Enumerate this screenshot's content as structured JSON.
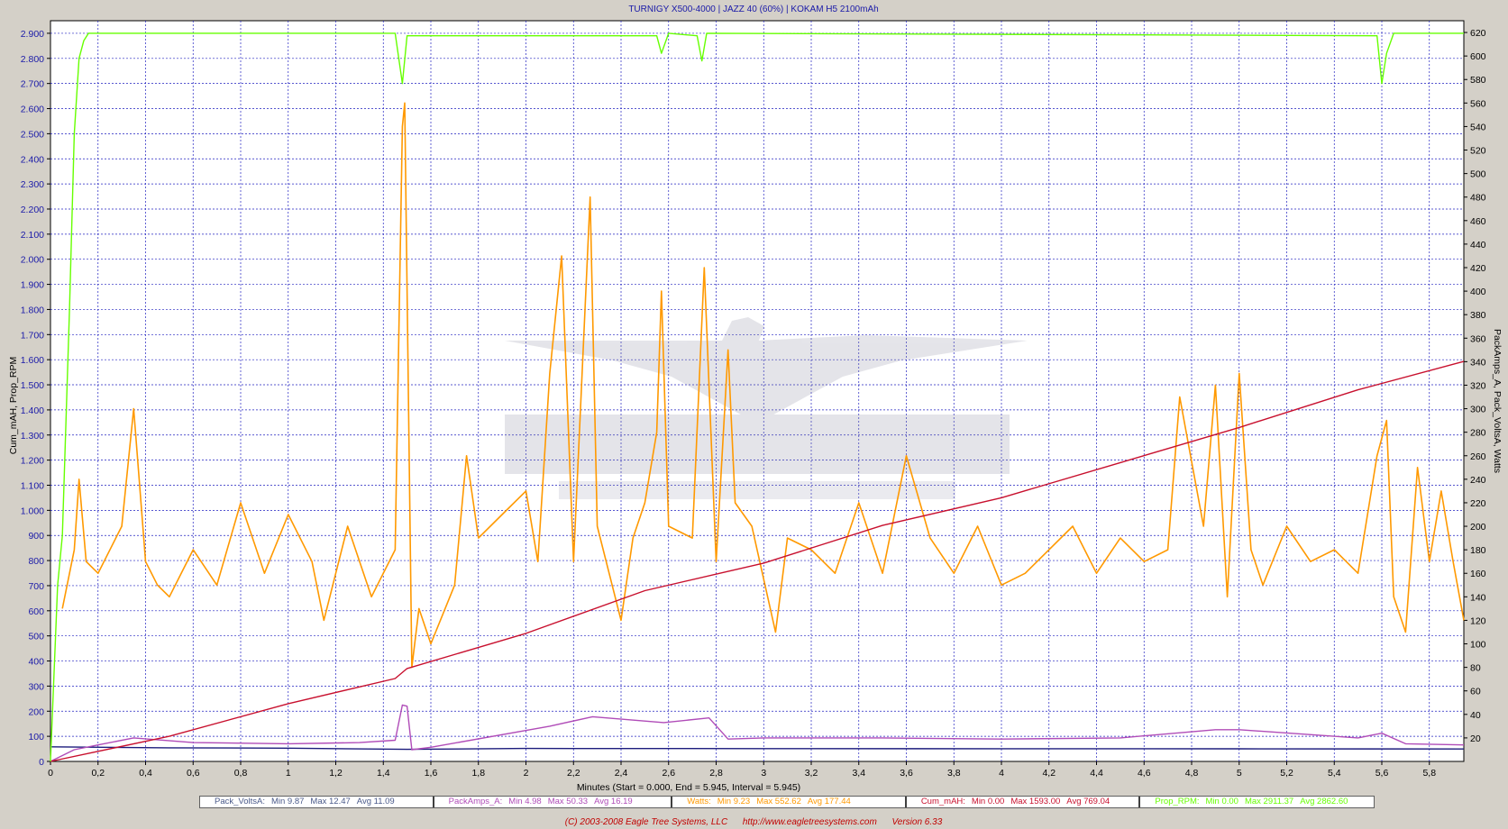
{
  "chart_data": {
    "type": "line",
    "title": "TURNIGY X500-4000 | JAZZ 40 (60%) | KOKAM H5 2100mAh",
    "xlabel": "Minutes (Start = 0.000,  End = 5.945,  Interval =  5.945)",
    "ylabel_left": "Cum_mAH, Prop_RPM",
    "ylabel_right": "PackAmps_A, Pack_VoltsA, Watts",
    "xlim": [
      0,
      5.945
    ],
    "ylim_left": [
      0,
      2950
    ],
    "ylim_right": [
      0,
      630
    ],
    "x_ticks": [
      "0",
      "0,2",
      "0,4",
      "0,6",
      "0,8",
      "1",
      "1,2",
      "1,4",
      "1,6",
      "1,8",
      "2",
      "2,2",
      "2,4",
      "2,6",
      "2,8",
      "3",
      "3,2",
      "3,4",
      "3,6",
      "3,8",
      "4",
      "4,2",
      "4,4",
      "4,6",
      "4,8",
      "5",
      "5,2",
      "5,4",
      "5,6",
      "5,8"
    ],
    "y_left_ticks": [
      "0",
      "100",
      "200",
      "300",
      "400",
      "500",
      "600",
      "700",
      "800",
      "900",
      "1.000",
      "1.100",
      "1.200",
      "1.300",
      "1.400",
      "1.500",
      "1.600",
      "1.700",
      "1.800",
      "1.900",
      "2.000",
      "2.100",
      "2.200",
      "2.300",
      "2.400",
      "2.500",
      "2.600",
      "2.700",
      "2.800",
      "2.900"
    ],
    "y_right_ticks": [
      "20",
      "40",
      "60",
      "80",
      "100",
      "120",
      "140",
      "160",
      "180",
      "200",
      "220",
      "240",
      "260",
      "280",
      "300",
      "320",
      "340",
      "360",
      "380",
      "400",
      "420",
      "440",
      "460",
      "480",
      "500",
      "520",
      "540",
      "560",
      "580",
      "600",
      "620"
    ],
    "grid": true,
    "legend_placement": "bottom",
    "series": [
      {
        "name": "Pack_VoltsA",
        "axis": "right",
        "color": "#1c1c7c",
        "points": [
          [
            0,
            12.4
          ],
          [
            0.5,
            11.6
          ],
          [
            1,
            11.3
          ],
          [
            1.5,
            10.3
          ],
          [
            2,
            11.0
          ],
          [
            3,
            10.9
          ],
          [
            4,
            10.8
          ],
          [
            5,
            10.7
          ],
          [
            5.945,
            10.6
          ]
        ],
        "stats": {
          "Min": "9.87",
          "Max": "12.47",
          "Avg": "11.09"
        }
      },
      {
        "name": "PackAmps_A",
        "axis": "right",
        "color": "#b04cb8",
        "points": [
          [
            0,
            0
          ],
          [
            0.05,
            5
          ],
          [
            0.1,
            10
          ],
          [
            0.2,
            14
          ],
          [
            0.35,
            20
          ],
          [
            0.6,
            16
          ],
          [
            1.0,
            15
          ],
          [
            1.3,
            16
          ],
          [
            1.45,
            18
          ],
          [
            1.48,
            48
          ],
          [
            1.5,
            47
          ],
          [
            1.52,
            10
          ],
          [
            1.6,
            12
          ],
          [
            2.1,
            30
          ],
          [
            2.28,
            38
          ],
          [
            2.58,
            33
          ],
          [
            2.77,
            37
          ],
          [
            2.85,
            19
          ],
          [
            3.0,
            20
          ],
          [
            3.5,
            20
          ],
          [
            4.0,
            19
          ],
          [
            4.5,
            20
          ],
          [
            4.9,
            27
          ],
          [
            5.0,
            27
          ],
          [
            5.5,
            20
          ],
          [
            5.6,
            24
          ],
          [
            5.7,
            15
          ],
          [
            5.945,
            14
          ]
        ],
        "stats": {
          "Min": "4.98",
          "Max": "50.33",
          "Avg": "16.19"
        }
      },
      {
        "name": "Watts",
        "axis": "right",
        "color": "#ff9900",
        "points": [
          [
            0.05,
            130
          ],
          [
            0.1,
            180
          ],
          [
            0.12,
            240
          ],
          [
            0.15,
            170
          ],
          [
            0.2,
            160
          ],
          [
            0.3,
            200
          ],
          [
            0.35,
            300
          ],
          [
            0.4,
            170
          ],
          [
            0.45,
            150
          ],
          [
            0.5,
            140
          ],
          [
            0.6,
            180
          ],
          [
            0.7,
            150
          ],
          [
            0.8,
            220
          ],
          [
            0.9,
            160
          ],
          [
            1.0,
            210
          ],
          [
            1.1,
            170
          ],
          [
            1.15,
            120
          ],
          [
            1.25,
            200
          ],
          [
            1.35,
            140
          ],
          [
            1.45,
            180
          ],
          [
            1.48,
            540
          ],
          [
            1.49,
            560
          ],
          [
            1.52,
            80
          ],
          [
            1.55,
            130
          ],
          [
            1.6,
            100
          ],
          [
            1.7,
            150
          ],
          [
            1.75,
            260
          ],
          [
            1.8,
            190
          ],
          [
            1.9,
            210
          ],
          [
            2.0,
            230
          ],
          [
            2.05,
            170
          ],
          [
            2.1,
            330
          ],
          [
            2.15,
            430
          ],
          [
            2.2,
            170
          ],
          [
            2.27,
            480
          ],
          [
            2.3,
            200
          ],
          [
            2.4,
            120
          ],
          [
            2.45,
            190
          ],
          [
            2.5,
            220
          ],
          [
            2.55,
            280
          ],
          [
            2.57,
            400
          ],
          [
            2.6,
            200
          ],
          [
            2.7,
            190
          ],
          [
            2.75,
            420
          ],
          [
            2.8,
            170
          ],
          [
            2.85,
            350
          ],
          [
            2.88,
            220
          ],
          [
            2.95,
            200
          ],
          [
            3.05,
            110
          ],
          [
            3.1,
            190
          ],
          [
            3.2,
            180
          ],
          [
            3.3,
            160
          ],
          [
            3.4,
            220
          ],
          [
            3.5,
            160
          ],
          [
            3.6,
            260
          ],
          [
            3.7,
            190
          ],
          [
            3.8,
            160
          ],
          [
            3.9,
            200
          ],
          [
            4.0,
            150
          ],
          [
            4.1,
            160
          ],
          [
            4.2,
            180
          ],
          [
            4.3,
            200
          ],
          [
            4.4,
            160
          ],
          [
            4.5,
            190
          ],
          [
            4.6,
            170
          ],
          [
            4.7,
            180
          ],
          [
            4.75,
            310
          ],
          [
            4.85,
            200
          ],
          [
            4.9,
            320
          ],
          [
            4.95,
            140
          ],
          [
            5.0,
            330
          ],
          [
            5.05,
            180
          ],
          [
            5.1,
            150
          ],
          [
            5.2,
            200
          ],
          [
            5.3,
            170
          ],
          [
            5.4,
            180
          ],
          [
            5.5,
            160
          ],
          [
            5.58,
            260
          ],
          [
            5.62,
            290
          ],
          [
            5.65,
            140
          ],
          [
            5.7,
            110
          ],
          [
            5.75,
            250
          ],
          [
            5.8,
            170
          ],
          [
            5.85,
            230
          ],
          [
            5.9,
            170
          ],
          [
            5.945,
            120
          ]
        ],
        "stats": {
          "Min": "9.23",
          "Max": "552.62",
          "Avg": "177.44"
        }
      },
      {
        "name": "Cum_mAH",
        "axis": "left",
        "color": "#c8102e",
        "points": [
          [
            0,
            0
          ],
          [
            0.5,
            100
          ],
          [
            1.0,
            230
          ],
          [
            1.45,
            330
          ],
          [
            1.5,
            370
          ],
          [
            2.0,
            510
          ],
          [
            2.5,
            680
          ],
          [
            3.0,
            790
          ],
          [
            3.5,
            940
          ],
          [
            4.0,
            1050
          ],
          [
            4.5,
            1190
          ],
          [
            5.0,
            1330
          ],
          [
            5.5,
            1480
          ],
          [
            5.945,
            1593
          ]
        ],
        "stats": {
          "Min": "0.00",
          "Max": "1593.00",
          "Avg": "769.04"
        }
      },
      {
        "name": "Prop_RPM",
        "axis": "left",
        "color": "#66ff00",
        "points": [
          [
            0,
            0
          ],
          [
            0.03,
            700
          ],
          [
            0.05,
            900
          ],
          [
            0.08,
            1800
          ],
          [
            0.1,
            2500
          ],
          [
            0.12,
            2800
          ],
          [
            0.14,
            2870
          ],
          [
            0.16,
            2900
          ],
          [
            1.45,
            2900
          ],
          [
            1.48,
            2700
          ],
          [
            1.5,
            2890
          ],
          [
            2.55,
            2890
          ],
          [
            2.57,
            2820
          ],
          [
            2.6,
            2900
          ],
          [
            2.72,
            2890
          ],
          [
            2.74,
            2790
          ],
          [
            2.76,
            2900
          ],
          [
            5.58,
            2890
          ],
          [
            5.6,
            2700
          ],
          [
            5.62,
            2820
          ],
          [
            5.65,
            2900
          ],
          [
            5.945,
            2900
          ]
        ],
        "stats": {
          "Min": "0.00",
          "Max": "2911.37",
          "Avg": "2862.60"
        }
      }
    ],
    "footer": "(C) 2003-2008 Eagle Tree Systems, LLC      http://www.eagletreesystems.com      Version 6.33"
  }
}
